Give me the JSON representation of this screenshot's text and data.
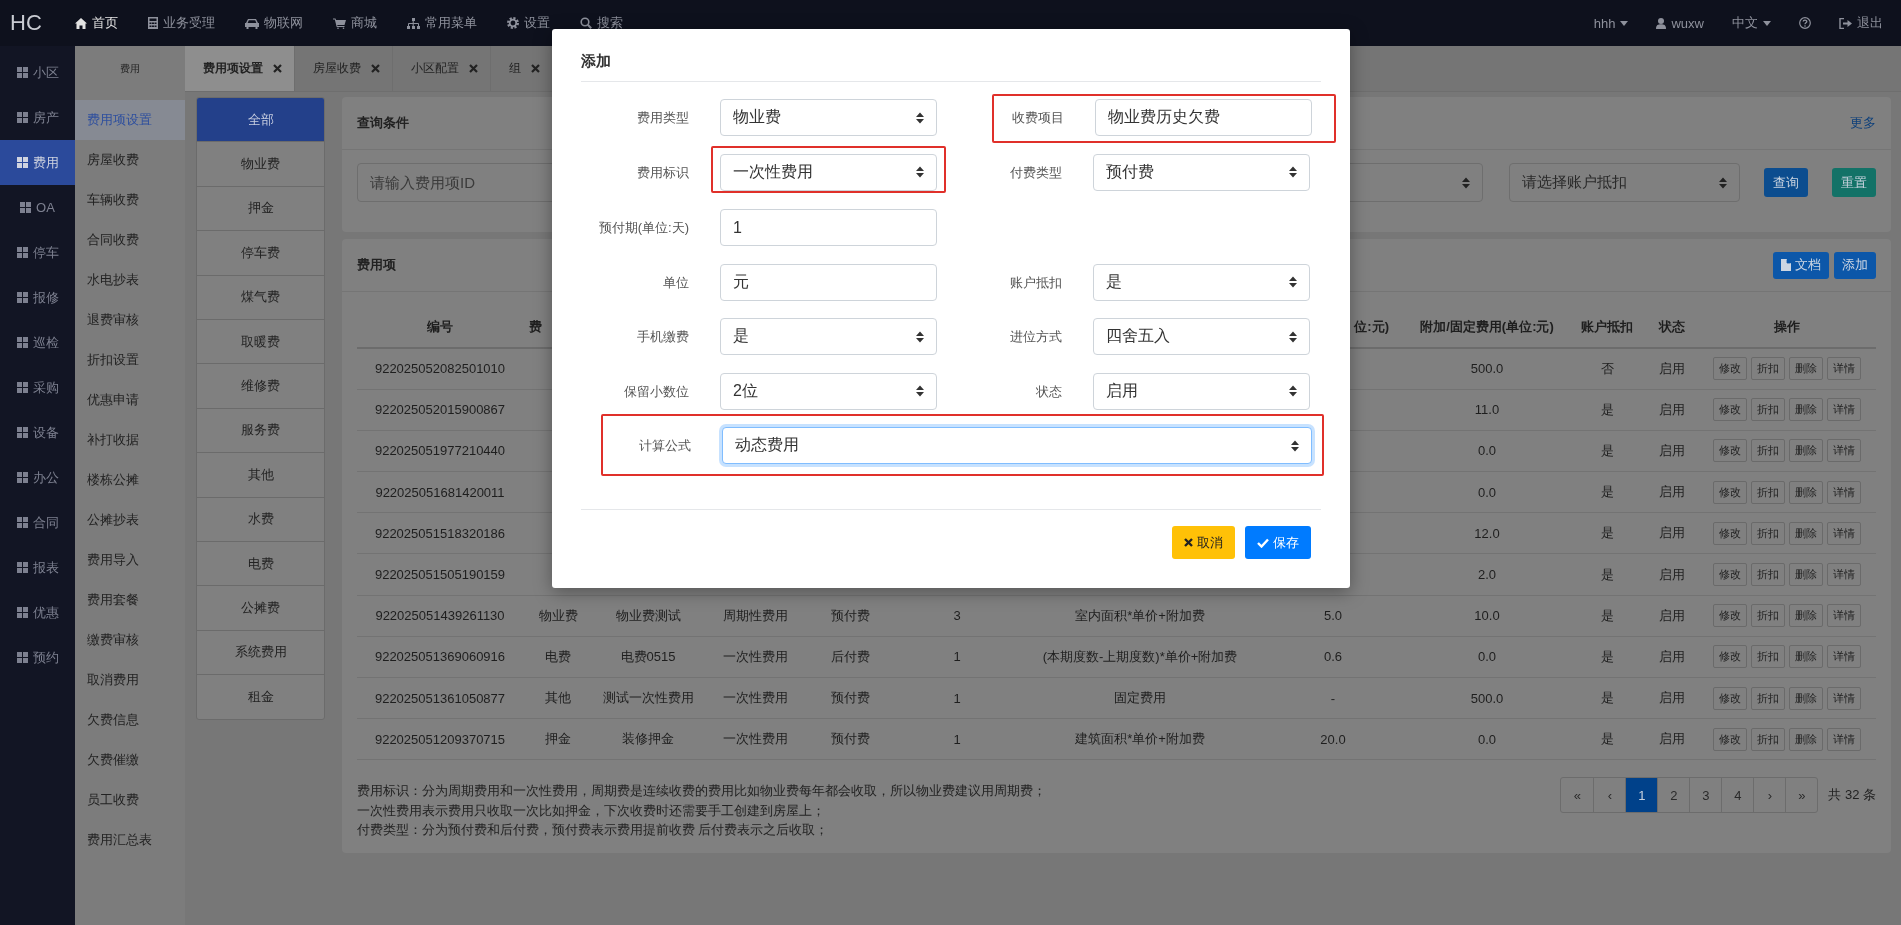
{
  "topbar": {
    "logo": "HC",
    "nav": [
      {
        "label": "首页",
        "selected": true
      },
      {
        "label": "业务受理",
        "selected": false
      },
      {
        "label": "物联网",
        "selected": false
      },
      {
        "label": "商城",
        "selected": false
      },
      {
        "label": "常用菜单",
        "selected": false
      },
      {
        "label": "设置",
        "selected": false
      },
      {
        "label": "搜索",
        "selected": false
      }
    ],
    "account": "hhh",
    "user": "wuxw",
    "language": "中文",
    "logout": "退出"
  },
  "sidebar": {
    "items": [
      {
        "label": "小区",
        "selected": false
      },
      {
        "label": "房产",
        "selected": false
      },
      {
        "label": "费用",
        "selected": true
      },
      {
        "label": "OA",
        "selected": false
      },
      {
        "label": "停车",
        "selected": false
      },
      {
        "label": "报修",
        "selected": false
      },
      {
        "label": "巡检",
        "selected": false
      },
      {
        "label": "采购",
        "selected": false
      },
      {
        "label": "设备",
        "selected": false
      },
      {
        "label": "办公",
        "selected": false
      },
      {
        "label": "合同",
        "selected": false
      },
      {
        "label": "报表",
        "selected": false
      },
      {
        "label": "优惠",
        "selected": false
      },
      {
        "label": "预约",
        "selected": false
      }
    ]
  },
  "submenu": {
    "title": "费用",
    "items": [
      {
        "label": "费用项设置",
        "selected": true
      },
      {
        "label": "房屋收费",
        "selected": false
      },
      {
        "label": "车辆收费",
        "selected": false
      },
      {
        "label": "合同收费",
        "selected": false
      },
      {
        "label": "水电抄表",
        "selected": false
      },
      {
        "label": "退费审核",
        "selected": false
      },
      {
        "label": "折扣设置",
        "selected": false
      },
      {
        "label": "优惠申请",
        "selected": false
      },
      {
        "label": "补打收据",
        "selected": false
      },
      {
        "label": "楼栋公摊",
        "selected": false
      },
      {
        "label": "公摊抄表",
        "selected": false
      },
      {
        "label": "费用导入",
        "selected": false
      },
      {
        "label": "费用套餐",
        "selected": false
      },
      {
        "label": "缴费审核",
        "selected": false
      },
      {
        "label": "取消费用",
        "selected": false
      },
      {
        "label": "欠费信息",
        "selected": false
      },
      {
        "label": "欠费催缴",
        "selected": false
      },
      {
        "label": "员工收费",
        "selected": false
      },
      {
        "label": "费用汇总表",
        "selected": false
      }
    ]
  },
  "tabs": [
    {
      "label": "费用项设置",
      "selected": true
    },
    {
      "label": "房屋收费",
      "selected": false
    },
    {
      "label": "小区配置",
      "selected": false
    },
    {
      "label": "组",
      "selected": false
    }
  ],
  "categories": [
    {
      "label": "全部",
      "selected": true
    },
    {
      "label": "物业费",
      "selected": false
    },
    {
      "label": "押金",
      "selected": false
    },
    {
      "label": "停车费",
      "selected": false
    },
    {
      "label": "煤气费",
      "selected": false
    },
    {
      "label": "取暖费",
      "selected": false
    },
    {
      "label": "维修费",
      "selected": false
    },
    {
      "label": "服务费",
      "selected": false
    },
    {
      "label": "其他",
      "selected": false
    },
    {
      "label": "水费",
      "selected": false
    },
    {
      "label": "电费",
      "selected": false
    },
    {
      "label": "公摊费",
      "selected": false
    },
    {
      "label": "系统费用",
      "selected": false
    },
    {
      "label": "租金",
      "selected": false
    }
  ],
  "query_panel": {
    "title": "查询条件",
    "more": "更多",
    "id_placeholder": "请输入费用项ID",
    "deduct_placeholder": "请选择账户抵扣",
    "search_button": "查询",
    "reset_button": "重置"
  },
  "fee_panel": {
    "title": "费用项",
    "doc_button": "文档",
    "add_button": "添加",
    "table": {
      "header": {
        "id": "编号",
        "fee_type": "费",
        "price": "位:元)",
        "extra": "附加/固定费用(单位:元)",
        "deduct": "账户抵扣",
        "status": "状态",
        "actions": "操作"
      },
      "rows": [
        {
          "id": "922025052082501010",
          "extra": "500.0",
          "deduct": "否",
          "status": "启用",
          "actions": [
            "修改",
            "折扣",
            "删除",
            "详情"
          ]
        },
        {
          "id": "922025052015900867",
          "extra": "11.0",
          "deduct": "是",
          "status": "启用",
          "actions": [
            "修改",
            "折扣",
            "删除",
            "详情"
          ]
        },
        {
          "id": "922025051977210440",
          "extra": "0.0",
          "deduct": "是",
          "status": "启用",
          "actions": [
            "修改",
            "折扣",
            "删除",
            "详情"
          ]
        },
        {
          "id": "922025051681420011",
          "extra": "0.0",
          "deduct": "是",
          "status": "启用",
          "actions": [
            "修改",
            "折扣",
            "删除",
            "详情"
          ]
        },
        {
          "id": "922025051518320186",
          "extra": "12.0",
          "deduct": "是",
          "status": "启用",
          "actions": [
            "修改",
            "折扣",
            "删除",
            "详情"
          ]
        },
        {
          "id": "922025051505190159",
          "extra": "2.0",
          "deduct": "是",
          "status": "启用",
          "actions": [
            "修改",
            "折扣",
            "删除",
            "详情"
          ]
        },
        {
          "id": "922025051439261130",
          "fee_type": "物业费",
          "item": "物业费测试",
          "flag": "周期性费用",
          "pay_type": "预付费",
          "period": "3",
          "formula": "室内面积*单价+附加费",
          "price": "5.0",
          "extra": "10.0",
          "deduct": "是",
          "status": "启用",
          "actions": [
            "修改",
            "折扣",
            "删除",
            "详情"
          ]
        },
        {
          "id": "922025051369060916",
          "fee_type": "电费",
          "item": "电费0515",
          "flag": "一次性费用",
          "pay_type": "后付费",
          "period": "1",
          "formula": "(本期度数-上期度数)*单价+附加费",
          "price": "0.6",
          "extra": "0.0",
          "deduct": "是",
          "status": "启用",
          "actions": [
            "修改",
            "折扣",
            "删除",
            "详情"
          ]
        },
        {
          "id": "922025051361050877",
          "fee_type": "其他",
          "item": "测试一次性费用",
          "flag": "一次性费用",
          "pay_type": "预付费",
          "period": "1",
          "formula": "固定费用",
          "price": "-",
          "extra": "500.0",
          "deduct": "是",
          "status": "启用",
          "actions": [
            "修改",
            "折扣",
            "删除",
            "详情"
          ]
        },
        {
          "id": "922025051209370715",
          "fee_type": "押金",
          "item": "装修押金",
          "flag": "一次性费用",
          "pay_type": "预付费",
          "period": "1",
          "formula": "建筑面积*单价+附加费",
          "price": "20.0",
          "extra": "0.0",
          "deduct": "是",
          "status": "启用",
          "actions": [
            "修改",
            "折扣",
            "删除",
            "详情"
          ]
        }
      ]
    },
    "notes": [
      "费用标识：分为周期费用和一次性费用，周期费是连续收费的费用比如物业费每年都会收取，所以物业费建议用周期费；",
      "一次性费用表示费用只收取一次比如押金，下次收费时还需要手工创建到房屋上；",
      "付费类型：分为预付费和后付费，预付费表示费用提前收费 后付费表示之后收取；"
    ],
    "pagination": {
      "pages": [
        {
          "label": "«",
          "selected": false
        },
        {
          "label": "‹",
          "selected": false
        },
        {
          "label": "1",
          "selected": true
        },
        {
          "label": "2",
          "selected": false
        },
        {
          "label": "3",
          "selected": false
        },
        {
          "label": "4",
          "selected": false
        },
        {
          "label": "›",
          "selected": false
        },
        {
          "label": "»",
          "selected": false
        }
      ],
      "total": "共 32 条"
    }
  },
  "modal": {
    "title": "添加",
    "rows": [
      [
        {
          "label": "费用类型",
          "kind": "select",
          "value": "物业费",
          "highlighted": false,
          "field_highlighted": false,
          "focused": false
        },
        {
          "label": "收费项目",
          "kind": "input",
          "value": "物业费历史欠费",
          "highlighted": true,
          "field_highlighted": false,
          "focused": false
        }
      ],
      [
        {
          "label": "费用标识",
          "kind": "select",
          "value": "一次性费用",
          "highlighted": false,
          "field_highlighted": true,
          "focused": false
        },
        {
          "label": "付费类型",
          "kind": "select",
          "value": "预付费",
          "highlighted": false,
          "field_highlighted": false,
          "focused": false
        }
      ],
      [
        {
          "label": "预付期(单位:天)",
          "kind": "input",
          "value": "1",
          "highlighted": false,
          "field_highlighted": false,
          "focused": false
        }
      ],
      [
        {
          "label": "单位",
          "kind": "input",
          "value": "元",
          "highlighted": false,
          "field_highlighted": false,
          "focused": false
        },
        {
          "label": "账户抵扣",
          "kind": "select",
          "value": "是",
          "highlighted": false,
          "field_highlighted": false,
          "focused": false
        }
      ],
      [
        {
          "label": "手机缴费",
          "kind": "select",
          "value": "是",
          "highlighted": false,
          "field_highlighted": false,
          "focused": false
        },
        {
          "label": "进位方式",
          "kind": "select",
          "value": "四舍五入",
          "highlighted": false,
          "field_highlighted": false,
          "focused": false
        }
      ],
      [
        {
          "label": "保留小数位",
          "kind": "select",
          "value": "2位",
          "highlighted": false,
          "field_highlighted": false,
          "focused": false
        },
        {
          "label": "状态",
          "kind": "select",
          "value": "启用",
          "highlighted": false,
          "field_highlighted": false,
          "focused": false
        }
      ],
      [
        {
          "label": "计算公式",
          "kind": "wide_select",
          "value": "动态费用",
          "highlighted": true,
          "field_highlighted": false,
          "focused": true
        }
      ]
    ],
    "cancel": "取消",
    "save": "保存"
  }
}
